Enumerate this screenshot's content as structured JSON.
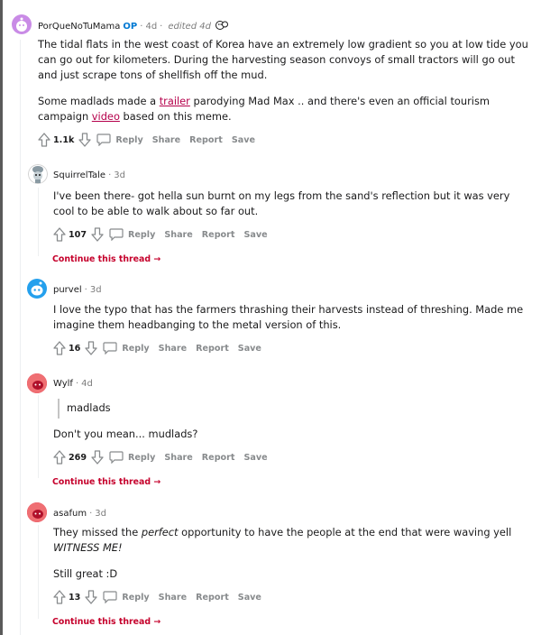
{
  "comments": [
    {
      "user": "PorQueNoTuMama",
      "op": "OP",
      "age": "4d",
      "edited": "edited 4d",
      "body_p1": "The tidal flats in the west coast of Korea have an extremely low gradient so you at low tide you can go out for kilometers. During the harvesting season convoys of small tractors will go out and just scrape tons of shellfish off the mud.",
      "body_p2_a": "Some madlads made a ",
      "link1": "trailer",
      "body_p2_b": " parodying Mad Max .. and there's even an official tourism campaign ",
      "link2": "video",
      "body_p2_c": " based on this meme.",
      "score": "1.1k",
      "reply": "Reply",
      "share": "Share",
      "report": "Report",
      "save": "Save",
      "avatar_color": "#c98be6"
    },
    {
      "user": "SquirrelTale",
      "age": "3d",
      "body": "I've been there- got hella sun burnt on my legs from the sand's reflection but it was very cool to be able to walk about so far out.",
      "score": "107",
      "reply": "Reply",
      "share": "Share",
      "report": "Report",
      "save": "Save",
      "continue": "Continue this thread"
    },
    {
      "user": "purvel",
      "age": "3d",
      "body": "I love the typo that has the farmers thrashing their harvests instead of threshing. Made me imagine them headbanging to the metal version of this.",
      "score": "16",
      "reply": "Reply",
      "share": "Share",
      "report": "Report",
      "save": "Save",
      "avatar_color": "#24a0ed"
    },
    {
      "user": "Wylf",
      "age": "4d",
      "quote": "madlads",
      "body": "Don't you mean... mudlads?",
      "score": "269",
      "reply": "Reply",
      "share": "Share",
      "report": "Report",
      "save": "Save",
      "continue": "Continue this thread",
      "avatar_color": "#ea0027"
    },
    {
      "user": "asafum",
      "age": "3d",
      "body_a": "They missed the ",
      "body_em": "perfect",
      "body_b": " opportunity to have the people at the end that were waving yell ",
      "body_em2": "WITNESS ME!",
      "body2": "Still great :D",
      "score": "13",
      "reply": "Reply",
      "share": "Share",
      "report": "Report",
      "save": "Save",
      "continue": "Continue this thread",
      "avatar_color": "#ea0027"
    }
  ],
  "colors": {
    "continue_link": "#c5002b",
    "action_gray": "#878a8c",
    "op_blue": "#0079d3"
  }
}
